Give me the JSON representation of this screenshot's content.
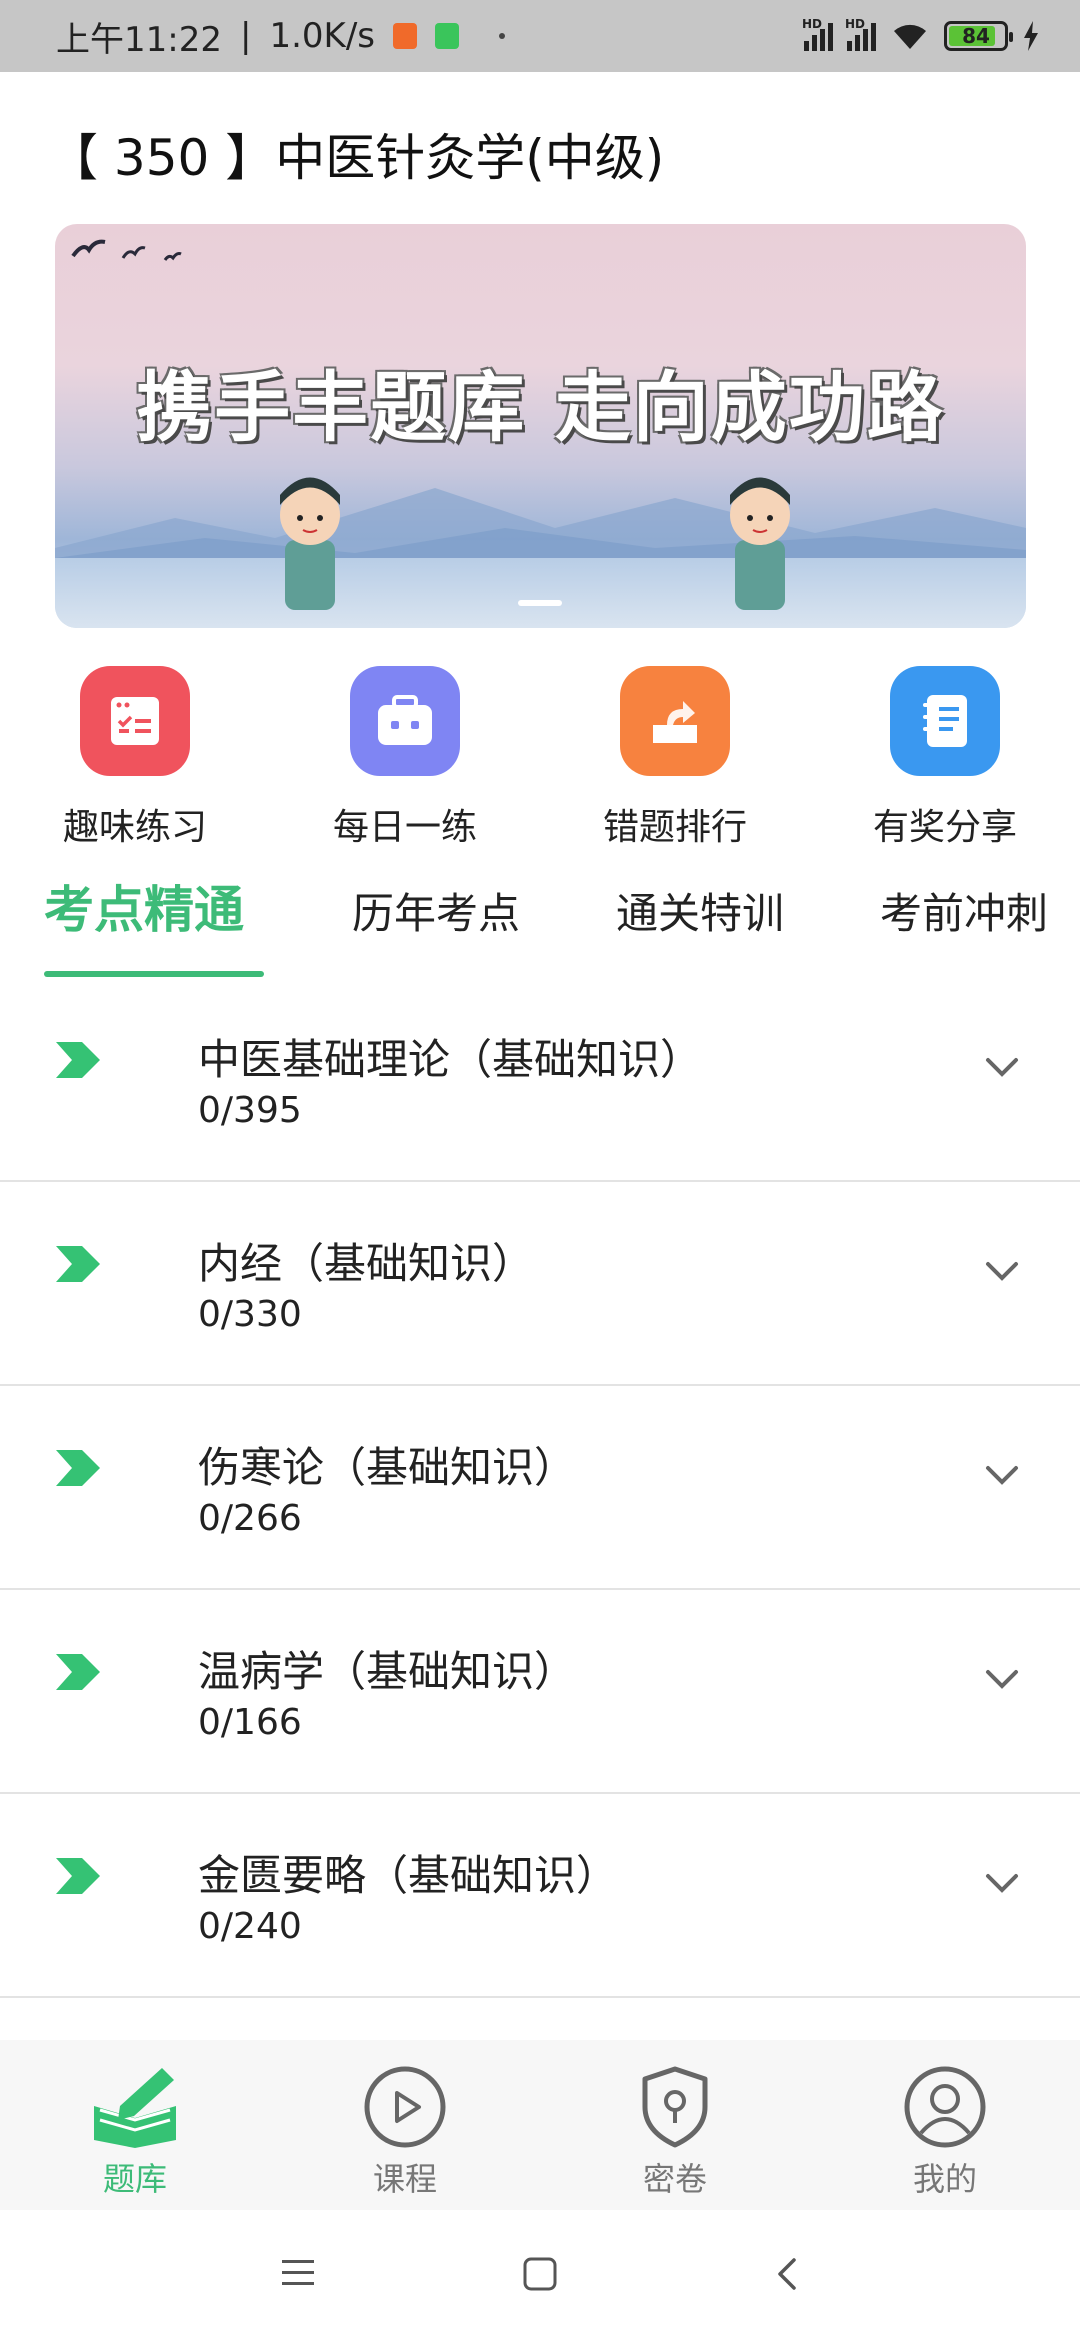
{
  "status_bar": {
    "time": "上午11:22",
    "net_speed": "1.0K/s",
    "battery": "84",
    "signal1_label": "HD",
    "signal2_label": "HD"
  },
  "page": {
    "title": "【 350 】中医针灸学(中级)"
  },
  "banner": {
    "slogan": "携手丰题库  走向成功路"
  },
  "quick_actions": [
    {
      "label": "趣味练习",
      "icon": "checklist-icon",
      "color": "#f0535d"
    },
    {
      "label": "每日一练",
      "icon": "briefcase-icon",
      "color": "#7f85f3"
    },
    {
      "label": "错题排行",
      "icon": "share-box-icon",
      "color": "#f7823f"
    },
    {
      "label": "有奖分享",
      "icon": "notebook-icon",
      "color": "#3a98f0"
    }
  ],
  "tabs": [
    {
      "label": "考点精通",
      "active": true
    },
    {
      "label": "历年考点",
      "active": false
    },
    {
      "label": "通关特训",
      "active": false
    },
    {
      "label": "考前冲刺",
      "active": false
    }
  ],
  "chapters": [
    {
      "name": "中医基础理论（基础知识）",
      "progress": "0/395"
    },
    {
      "name": "内经（基础知识）",
      "progress": "0/330"
    },
    {
      "name": "伤寒论（基础知识）",
      "progress": "0/266"
    },
    {
      "name": "温病学（基础知识）",
      "progress": "0/166"
    },
    {
      "name": "金匮要略（基础知识）",
      "progress": "0/240"
    }
  ],
  "bottom_nav": [
    {
      "label": "题库",
      "icon": "question-bank-icon",
      "active": true
    },
    {
      "label": "课程",
      "icon": "play-circle-icon",
      "active": false
    },
    {
      "label": "密卷",
      "icon": "shield-lock-icon",
      "active": false
    },
    {
      "label": "我的",
      "icon": "user-circle-icon",
      "active": false
    }
  ],
  "colors": {
    "accent": "#3dbb78"
  }
}
